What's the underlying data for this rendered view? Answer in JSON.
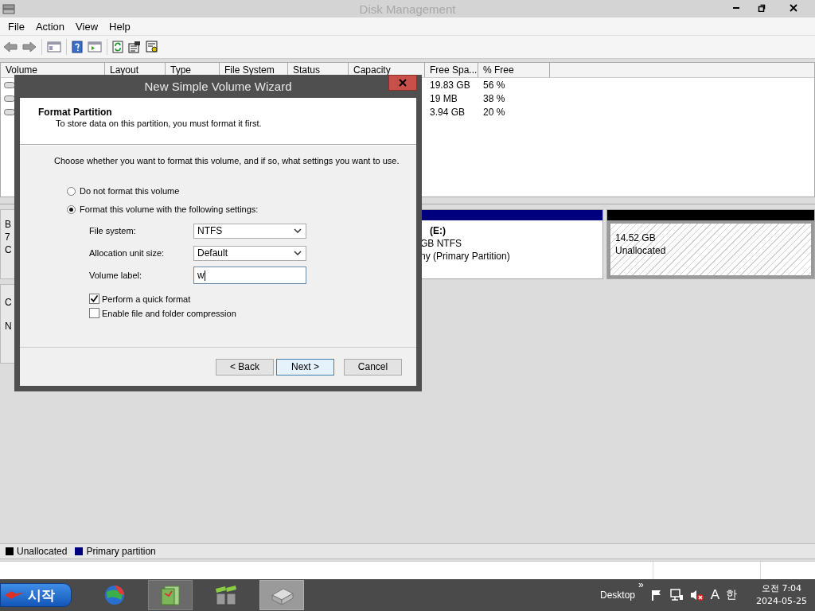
{
  "window": {
    "title": "Disk Management"
  },
  "menu": [
    "File",
    "Action",
    "View",
    "Help"
  ],
  "volume_list": {
    "columns": [
      "Volume",
      "Layout",
      "Type",
      "File System",
      "Status",
      "Capacity",
      "Free Spa...",
      "% Free"
    ],
    "rows": [
      {
        "free_space": "19.83 GB",
        "percent_free": "56 %"
      },
      {
        "free_space": "19 MB",
        "percent_free": "38 %"
      },
      {
        "free_space": "3.94 GB",
        "percent_free": "20 %"
      }
    ]
  },
  "disks": [
    {
      "label_fragments": [
        "B",
        "7",
        "C"
      ],
      "partitions": [
        {
          "kind": "primary",
          "color": "#00007f",
          "title": "(E:)",
          "lines": [
            "GB NTFS",
            "ny (Primary Partition)"
          ]
        },
        {
          "kind": "unallocated",
          "color": "#000000",
          "lines": [
            "14.52 GB",
            "Unallocated"
          ]
        }
      ]
    },
    {
      "label_fragments": [
        "C",
        "N"
      ]
    }
  ],
  "legend": [
    {
      "label": "Unallocated",
      "color": "#000000"
    },
    {
      "label": "Primary partition",
      "color": "#00007f"
    }
  ],
  "wizard": {
    "title": "New Simple Volume Wizard",
    "heading": "Format Partition",
    "subheading": "To store data on this partition, you must format it first.",
    "prompt": "Choose whether you want to format this volume, and if so, what settings you want to use.",
    "options": [
      {
        "label": "Do not format this volume",
        "selected": false
      },
      {
        "label": "Format this volume with the following settings:",
        "selected": true
      }
    ],
    "settings": [
      {
        "kind": "dropdown",
        "label": "File system:",
        "value": "NTFS"
      },
      {
        "kind": "dropdown",
        "label": "Allocation unit size:",
        "value": "Default"
      },
      {
        "kind": "text",
        "label": "Volume label:",
        "value": "w"
      }
    ],
    "checkboxes": [
      {
        "label": "Perform a quick format",
        "checked": true
      },
      {
        "label": "Enable file and folder compression",
        "checked": false
      }
    ],
    "buttons": [
      "< Back",
      "Next >",
      "Cancel"
    ]
  },
  "taskbar": {
    "start": "시작",
    "apps": [
      {
        "running": false,
        "selected": false
      },
      {
        "running": true,
        "selected": false
      },
      {
        "running": false,
        "selected": false
      },
      {
        "running": true,
        "selected": true
      }
    ],
    "toolbar_label": "Desktop",
    "chevron": "»",
    "ime_mode": "A",
    "ime_lang": "한",
    "time": "오전 7:04",
    "date": "2024-05-25"
  }
}
